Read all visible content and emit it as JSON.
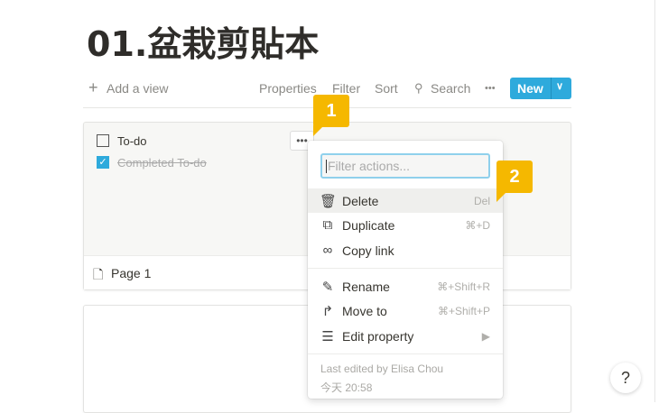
{
  "page": {
    "title": "01.盆栽剪貼本"
  },
  "toolbar": {
    "add_view": "Add a view",
    "properties": "Properties",
    "filter": "Filter",
    "sort": "Sort",
    "search": "Search",
    "more": "•••",
    "new": "New"
  },
  "card": {
    "todo": "To-do",
    "completed": "Completed To-do",
    "page_name": "Page 1",
    "more": "•••"
  },
  "menu": {
    "filter_placeholder": "Filter actions...",
    "items": [
      {
        "label": "Delete",
        "shortcut": "Del"
      },
      {
        "label": "Duplicate",
        "shortcut": "⌘+D"
      },
      {
        "label": "Copy link",
        "shortcut": ""
      },
      {
        "label": "Rename",
        "shortcut": "⌘+Shift+R"
      },
      {
        "label": "Move to",
        "shortcut": "⌘+Shift+P"
      },
      {
        "label": "Edit property",
        "shortcut": "▶"
      }
    ],
    "last_edited": "Last edited by Elisa Chou",
    "time": "今天 20:58"
  },
  "badges": [
    "1",
    "2"
  ],
  "help": "?",
  "colors": {
    "accent": "#2eaadc",
    "badge": "#f5b800"
  }
}
